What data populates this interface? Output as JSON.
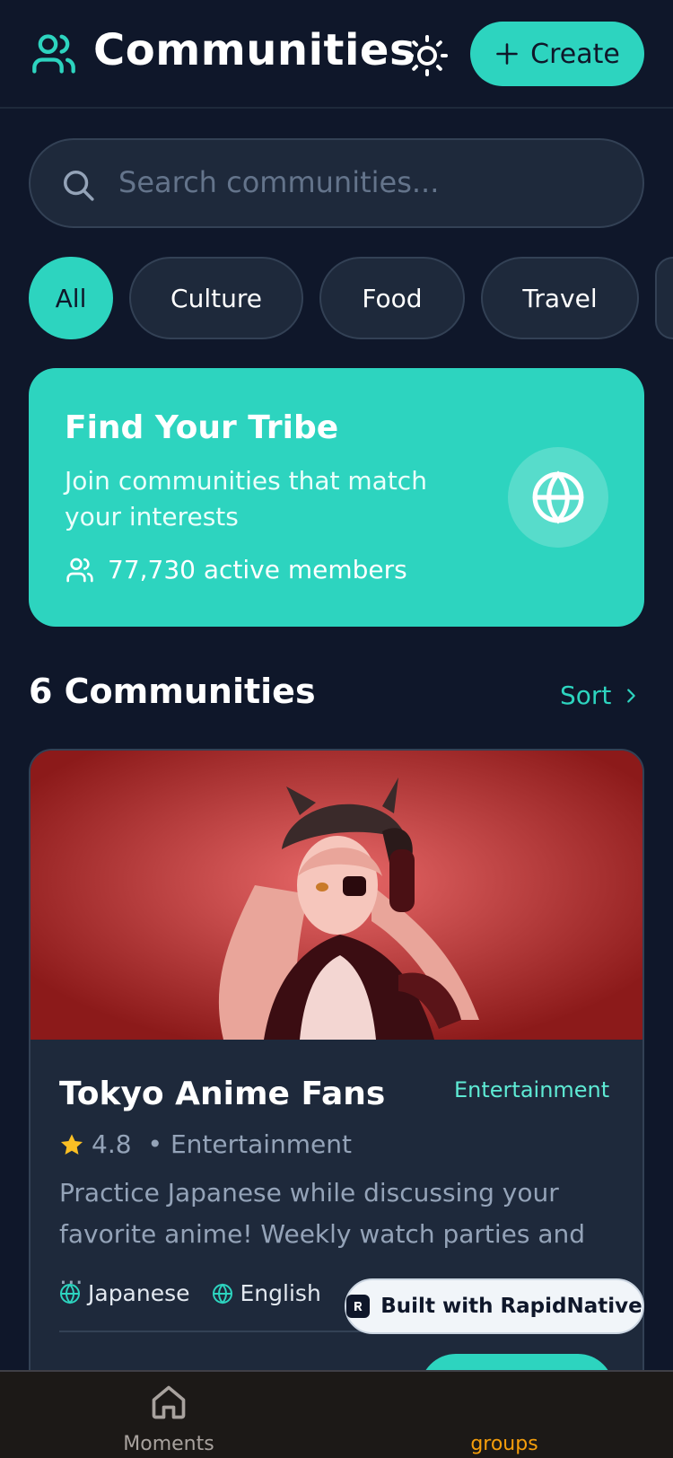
{
  "header": {
    "title": "Communities",
    "create_label": "Create"
  },
  "search": {
    "placeholder": "Search communities..."
  },
  "filters": [
    {
      "label": "All",
      "active": true
    },
    {
      "label": "Culture",
      "active": false
    },
    {
      "label": "Food",
      "active": false
    },
    {
      "label": "Travel",
      "active": false
    }
  ],
  "hero": {
    "title": "Find Your Tribe",
    "subtitle": "Join communities that match your interests",
    "members": "77,730 active members"
  },
  "section": {
    "title": "6 Communities",
    "sort_label": "Sort"
  },
  "card": {
    "name": "Tokyo Anime Fans",
    "tag": "Entertainment",
    "rating": "4.8",
    "category": "• Entertainment",
    "description": "Practice Japanese while discussing your favorite anime! Weekly watch parties and ...",
    "languages": [
      "Japanese",
      "English"
    ]
  },
  "badge": {
    "label": "Built with RapidNative"
  },
  "bottom_nav": {
    "home_label": "Moments",
    "groups_label": "groups"
  },
  "colors": {
    "background": "#0f172a",
    "accent": "#2dd4bf",
    "surface": "#1e293b",
    "nav_active": "#f59e0b"
  }
}
